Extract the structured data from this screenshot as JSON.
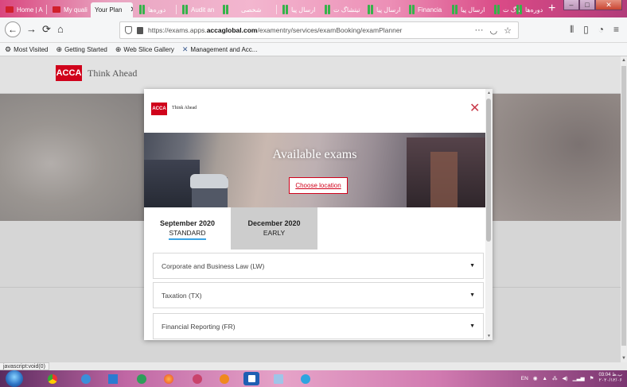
{
  "browser": {
    "tabs": [
      {
        "label": "Home | A",
        "icon": "acca-favicon",
        "active": false
      },
      {
        "label": "My quali",
        "icon": "acca-favicon",
        "active": false
      },
      {
        "label": "Your Plan",
        "icon": "none",
        "active": true
      },
      {
        "label": "دورەها",
        "icon": "bars-favicon",
        "active": false
      },
      {
        "label": "Audit an",
        "icon": "bars-favicon",
        "active": false
      },
      {
        "label": "",
        "icon": "bars-favicon",
        "active": false
      },
      {
        "label": "شخصی",
        "icon": "bars-favicon",
        "active": false
      },
      {
        "label": "ارسال پیا",
        "icon": "bars-favicon",
        "active": false
      },
      {
        "label": "تیتشاگ ت",
        "icon": "bars-favicon",
        "active": false
      },
      {
        "label": "ارسال پیا",
        "icon": "bars-favicon",
        "active": false
      },
      {
        "label": "Financia",
        "icon": "bars-favicon",
        "active": false
      },
      {
        "label": "ارسال پیا",
        "icon": "bars-favicon",
        "active": false
      },
      {
        "label": "تیتشاگ ت",
        "icon": "bars-favicon",
        "active": false
      },
      {
        "label": "",
        "icon": "bars-favicon",
        "active": false
      },
      {
        "label": "دورەها",
        "icon": "bars-favicon",
        "active": false
      }
    ],
    "close_tab_glyph": "✕",
    "new_tab_glyph": "+",
    "window_buttons": {
      "minimize": "–",
      "maximize": "□",
      "close": "✕"
    },
    "url": {
      "prefix": "https://exams.apps.",
      "domain": "accaglobal.com",
      "suffix": "/examentry/services/examBooking/examPlanner"
    },
    "url_actions": "···",
    "bookmarks": [
      {
        "label": "Most Visited",
        "icon": "gear-icon"
      },
      {
        "label": "Getting Started",
        "icon": "globe-icon"
      },
      {
        "label": "Web Slice Gallery",
        "icon": "globe-icon"
      },
      {
        "label": "Management and Acc...",
        "icon": "x-icon"
      }
    ],
    "status_url": "javascript:void(0)"
  },
  "page": {
    "logo": "ACCA",
    "tagline": "Think Ahead"
  },
  "modal": {
    "logo": "ACCA",
    "tagline": "Think Ahead",
    "close_glyph": "✕",
    "banner_title": "Available exams",
    "choose_location": "Choose location",
    "periods": [
      {
        "date": "September 2020",
        "type": "STANDARD",
        "selected": true
      },
      {
        "date": "December 2020",
        "type": "EARLY",
        "selected": false
      }
    ],
    "exams": [
      {
        "name": "Corporate and Business Law (LW)"
      },
      {
        "name": "Taxation (TX)"
      },
      {
        "name": "Financial Reporting (FR)"
      }
    ],
    "caret_glyph": "▼"
  },
  "taskbar": {
    "language": "EN",
    "time": "03:04 ب.ظ",
    "date": "۲۰۲۰/۱۲/۰۶"
  },
  "colors": {
    "acca_red": "#d0021b",
    "tab_underline": "#3aa3e3",
    "close_red": "#c93a4a"
  }
}
